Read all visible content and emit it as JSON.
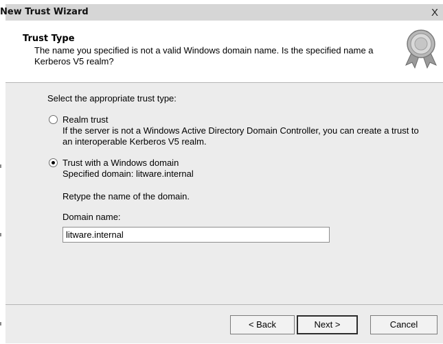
{
  "window": {
    "title": "New Trust Wizard",
    "close_glyph": "X"
  },
  "header": {
    "title": "Trust Type",
    "description": "The name you specified is not a valid Windows domain name. Is the specified name a Kerberos V5 realm?",
    "icon": "award-ribbon-icon"
  },
  "body": {
    "prompt": "Select the appropriate trust type:",
    "options": [
      {
        "label": "Realm trust",
        "description": "If the server is not a Windows Active Directory Domain Controller, you can create a trust to an interoperable Kerberos V5 realm.",
        "selected": false
      },
      {
        "label": "Trust with a Windows domain",
        "description": "Specified domain: litware.internal",
        "selected": true
      }
    ],
    "retype_prompt": "Retype the name of the domain.",
    "domain_field": {
      "label": "Domain name:",
      "value": "litware.internal"
    }
  },
  "buttons": {
    "back": "< Back",
    "next": "Next >",
    "cancel": "Cancel"
  }
}
